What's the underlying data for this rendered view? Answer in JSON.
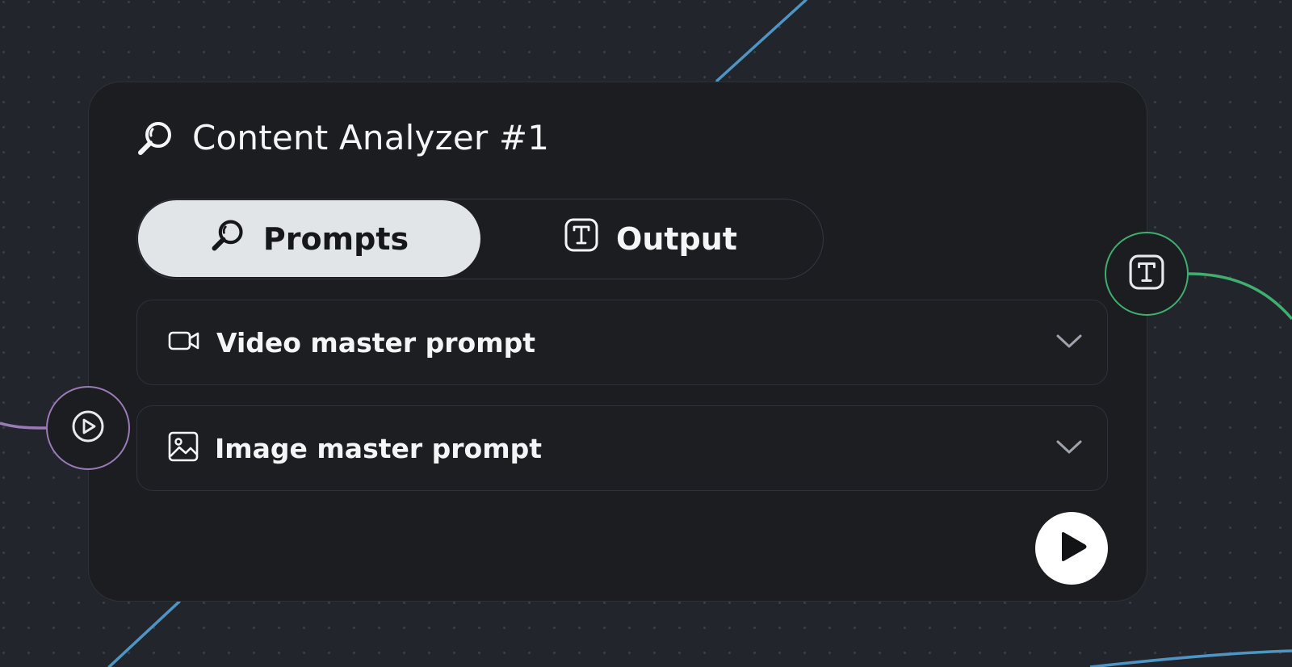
{
  "node": {
    "title": "Content Analyzer #1",
    "title_icon": "magnifier-icon"
  },
  "tabs": [
    {
      "label": "Prompts",
      "icon": "magnifier-icon",
      "active": true
    },
    {
      "label": "Output",
      "icon": "text-box-icon",
      "active": false
    }
  ],
  "sections": [
    {
      "label": "Video master prompt",
      "icon": "video-camera-icon",
      "expanded": false
    },
    {
      "label": "Image master prompt",
      "icon": "image-icon",
      "expanded": false
    }
  ],
  "ports": {
    "input": {
      "icon": "play-circle-icon",
      "color": "#9b7ab8"
    },
    "output": {
      "icon": "text-box-icon",
      "color": "#3fae6e"
    }
  },
  "run_button": {
    "icon": "play-icon"
  },
  "colors": {
    "canvas_background": "#22252b",
    "node_background": "#1b1d21",
    "active_tab": "#e2e5e8",
    "edge_blue": "#4f95c4",
    "edge_green": "#3fae6e",
    "edge_purple": "#9b7ab8"
  }
}
